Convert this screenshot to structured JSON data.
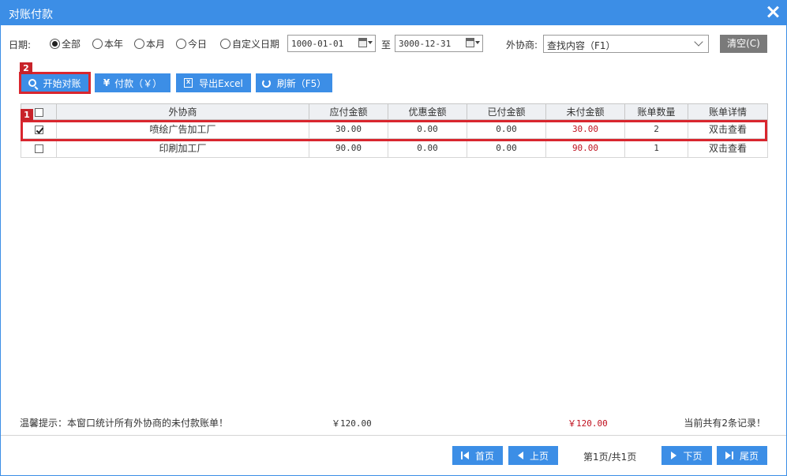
{
  "window": {
    "title": "对账付款"
  },
  "filters": {
    "date_label": "日期:",
    "radios": [
      {
        "label": "全部",
        "checked": true
      },
      {
        "label": "本年",
        "checked": false
      },
      {
        "label": "本月",
        "checked": false
      },
      {
        "label": "今日",
        "checked": false
      },
      {
        "label": "自定义日期",
        "checked": false
      }
    ],
    "date_from": "1000-01-01",
    "to_label": "至",
    "date_to": "3000-12-31",
    "vendor_label": "外协商:",
    "vendor_select": "查找内容（F1）",
    "clear_label": "清空(C)"
  },
  "toolbar": {
    "start_label": "开始对账",
    "pay_label": "付款（￥）",
    "export_label": "导出Excel",
    "refresh_label": "刷新（F5）"
  },
  "annotations": {
    "badge1": "1",
    "badge2": "2"
  },
  "table": {
    "columns": [
      "外协商",
      "应付金额",
      "优惠金额",
      "已付金额",
      "未付金额",
      "账单数量",
      "账单详情"
    ],
    "rows": [
      {
        "checked": true,
        "vendor": "喷绘广告加工厂",
        "payable": "30.00",
        "discount": "0.00",
        "paid": "0.00",
        "unpaid": "30.00",
        "bills": "2",
        "detail": "双击查看"
      },
      {
        "checked": false,
        "vendor": "印刷加工厂",
        "payable": "90.00",
        "discount": "0.00",
        "paid": "0.00",
        "unpaid": "90.00",
        "bills": "1",
        "detail": "双击查看"
      }
    ]
  },
  "summary": {
    "hint": "温馨提示：本窗口统计所有外协商的未付款账单！",
    "total_payable": "￥120.00",
    "total_unpaid": "￥120.00",
    "count_text": "当前共有2条记录！"
  },
  "pagination": {
    "first": "首页",
    "prev": "上页",
    "info": "第1页/共1页",
    "next": "下页",
    "last": "尾页"
  },
  "colors": {
    "accent": "#3c8ee6",
    "highlight": "#d9262e",
    "unpaid": "#c0111f"
  }
}
